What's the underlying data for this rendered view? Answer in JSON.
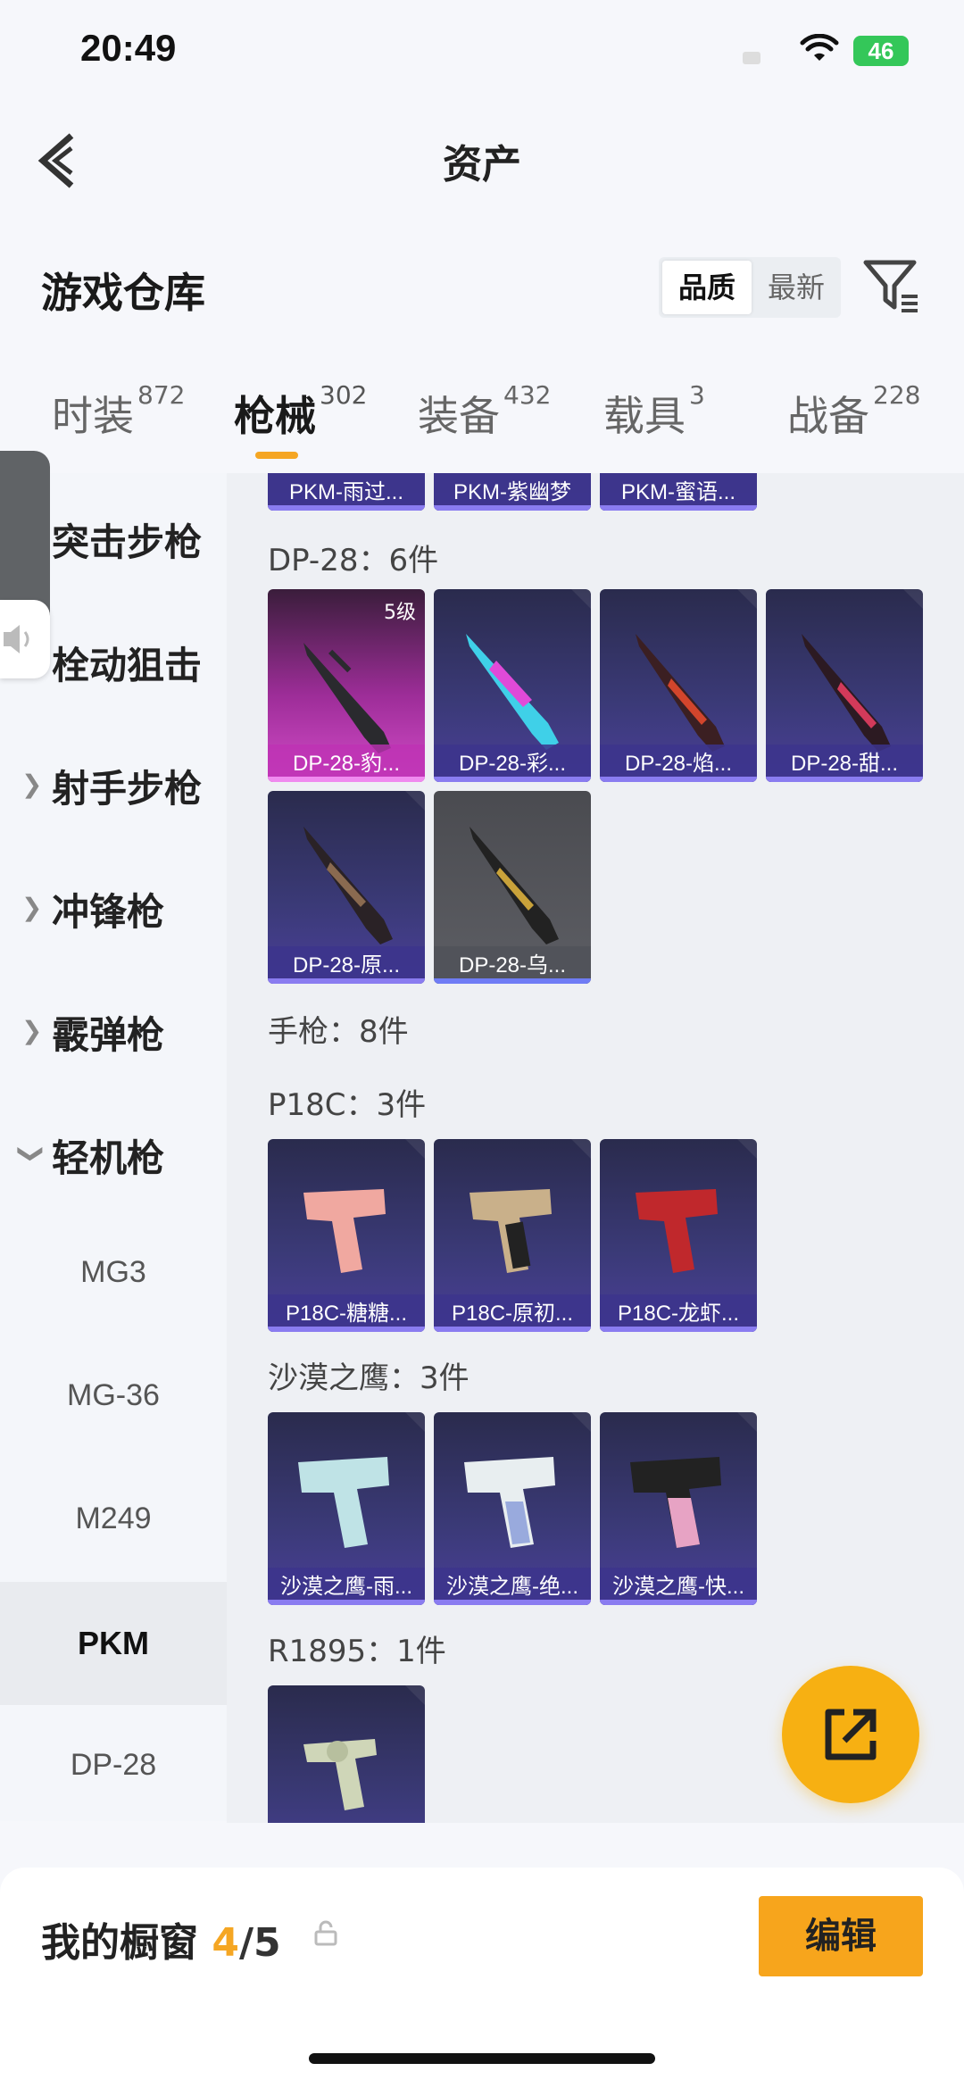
{
  "status": {
    "time": "20:49",
    "battery": "46"
  },
  "nav": {
    "title": "资产"
  },
  "warehouse": {
    "title": "游戏仓库",
    "sort_quality": "品质",
    "sort_newest": "最新"
  },
  "tabs": [
    {
      "label": "时装",
      "count": "872"
    },
    {
      "label": "枪械",
      "count": "302"
    },
    {
      "label": "装备",
      "count": "432"
    },
    {
      "label": "载具",
      "count": "3"
    },
    {
      "label": "战备",
      "count": "228"
    }
  ],
  "sidebar": {
    "categories": [
      "突击步枪",
      "栓动狙击",
      "射手步枪",
      "冲锋枪",
      "霰弹枪",
      "轻机枪"
    ],
    "subitems": [
      "MG3",
      "MG-36",
      "M249",
      "PKM",
      "DP-28"
    ]
  },
  "content": {
    "top_row": [
      "PKM-雨过...",
      "PKM-紫幽梦",
      "PKM-蜜语..."
    ],
    "dp28_header": "DP-28：6件",
    "dp28_items": [
      "DP-28-豹...",
      "DP-28-彩...",
      "DP-28-焰...",
      "DP-28-甜...",
      "DP-28-原...",
      "DP-28-乌..."
    ],
    "level_badge": "5级",
    "pistol_header": "手枪：8件",
    "p18c_header": "P18C：3件",
    "p18c_items": [
      "P18C-糖糖...",
      "P18C-原初...",
      "P18C-龙虾..."
    ],
    "deagle_header": "沙漠之鹰：3件",
    "deagle_items": [
      "沙漠之鹰-雨...",
      "沙漠之鹰-绝...",
      "沙漠之鹰-快..."
    ],
    "r1895_header": "R1895：1件"
  },
  "showcase": {
    "title": "我的橱窗",
    "count": "4",
    "total": "/5",
    "edit": "编辑"
  }
}
